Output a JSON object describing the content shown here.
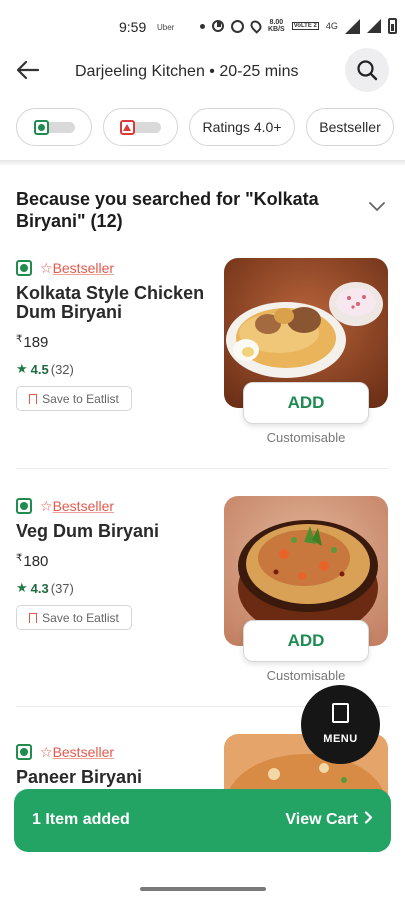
{
  "status_bar": {
    "time": "9:59",
    "app_label": "Uber",
    "speed_value": "8.00",
    "speed_unit": "KB/S",
    "volte_label": "VoLTE 2",
    "network_label": "4G"
  },
  "header": {
    "title": "Darjeeling Kitchen • 20-25 mins"
  },
  "filters": {
    "rating_label": "Ratings 4.0+",
    "bestseller_label": "Bestseller"
  },
  "section": {
    "title": "Because you searched for \"Kolkata Biryani\" (12)"
  },
  "items": [
    {
      "badge": "Bestseller",
      "name": "Kolkata Style Chicken Dum Biryani",
      "currency": "₹",
      "price": "189",
      "rating": "4.5",
      "rating_count": "(32)",
      "save_label": "Save to Eatlist",
      "add_label": "ADD",
      "custom_label": "Customisable"
    },
    {
      "badge": "Bestseller",
      "name": "Veg Dum Biryani",
      "currency": "₹",
      "price": "180",
      "rating": "4.3",
      "rating_count": "(37)",
      "save_label": "Save to Eatlist",
      "add_label": "ADD",
      "custom_label": "Customisable"
    },
    {
      "badge": "Bestseller",
      "name": "Paneer Biryani"
    }
  ],
  "menu_fab": {
    "label": "MENU"
  },
  "cart": {
    "count_label": "1 Item added",
    "view_label": "View Cart"
  },
  "colors": {
    "accent_green": "#24a464",
    "veg_green": "#228b50",
    "bestseller_red": "#e4594d",
    "nonveg_red": "#d93b3b"
  },
  "icons": [
    "back-arrow-icon",
    "search-icon",
    "veg-icon",
    "nonveg-icon",
    "bestseller-star-icon",
    "rating-star-icon",
    "bookmark-icon",
    "chevron-down-icon",
    "menu-book-icon",
    "chevron-right-icon"
  ]
}
